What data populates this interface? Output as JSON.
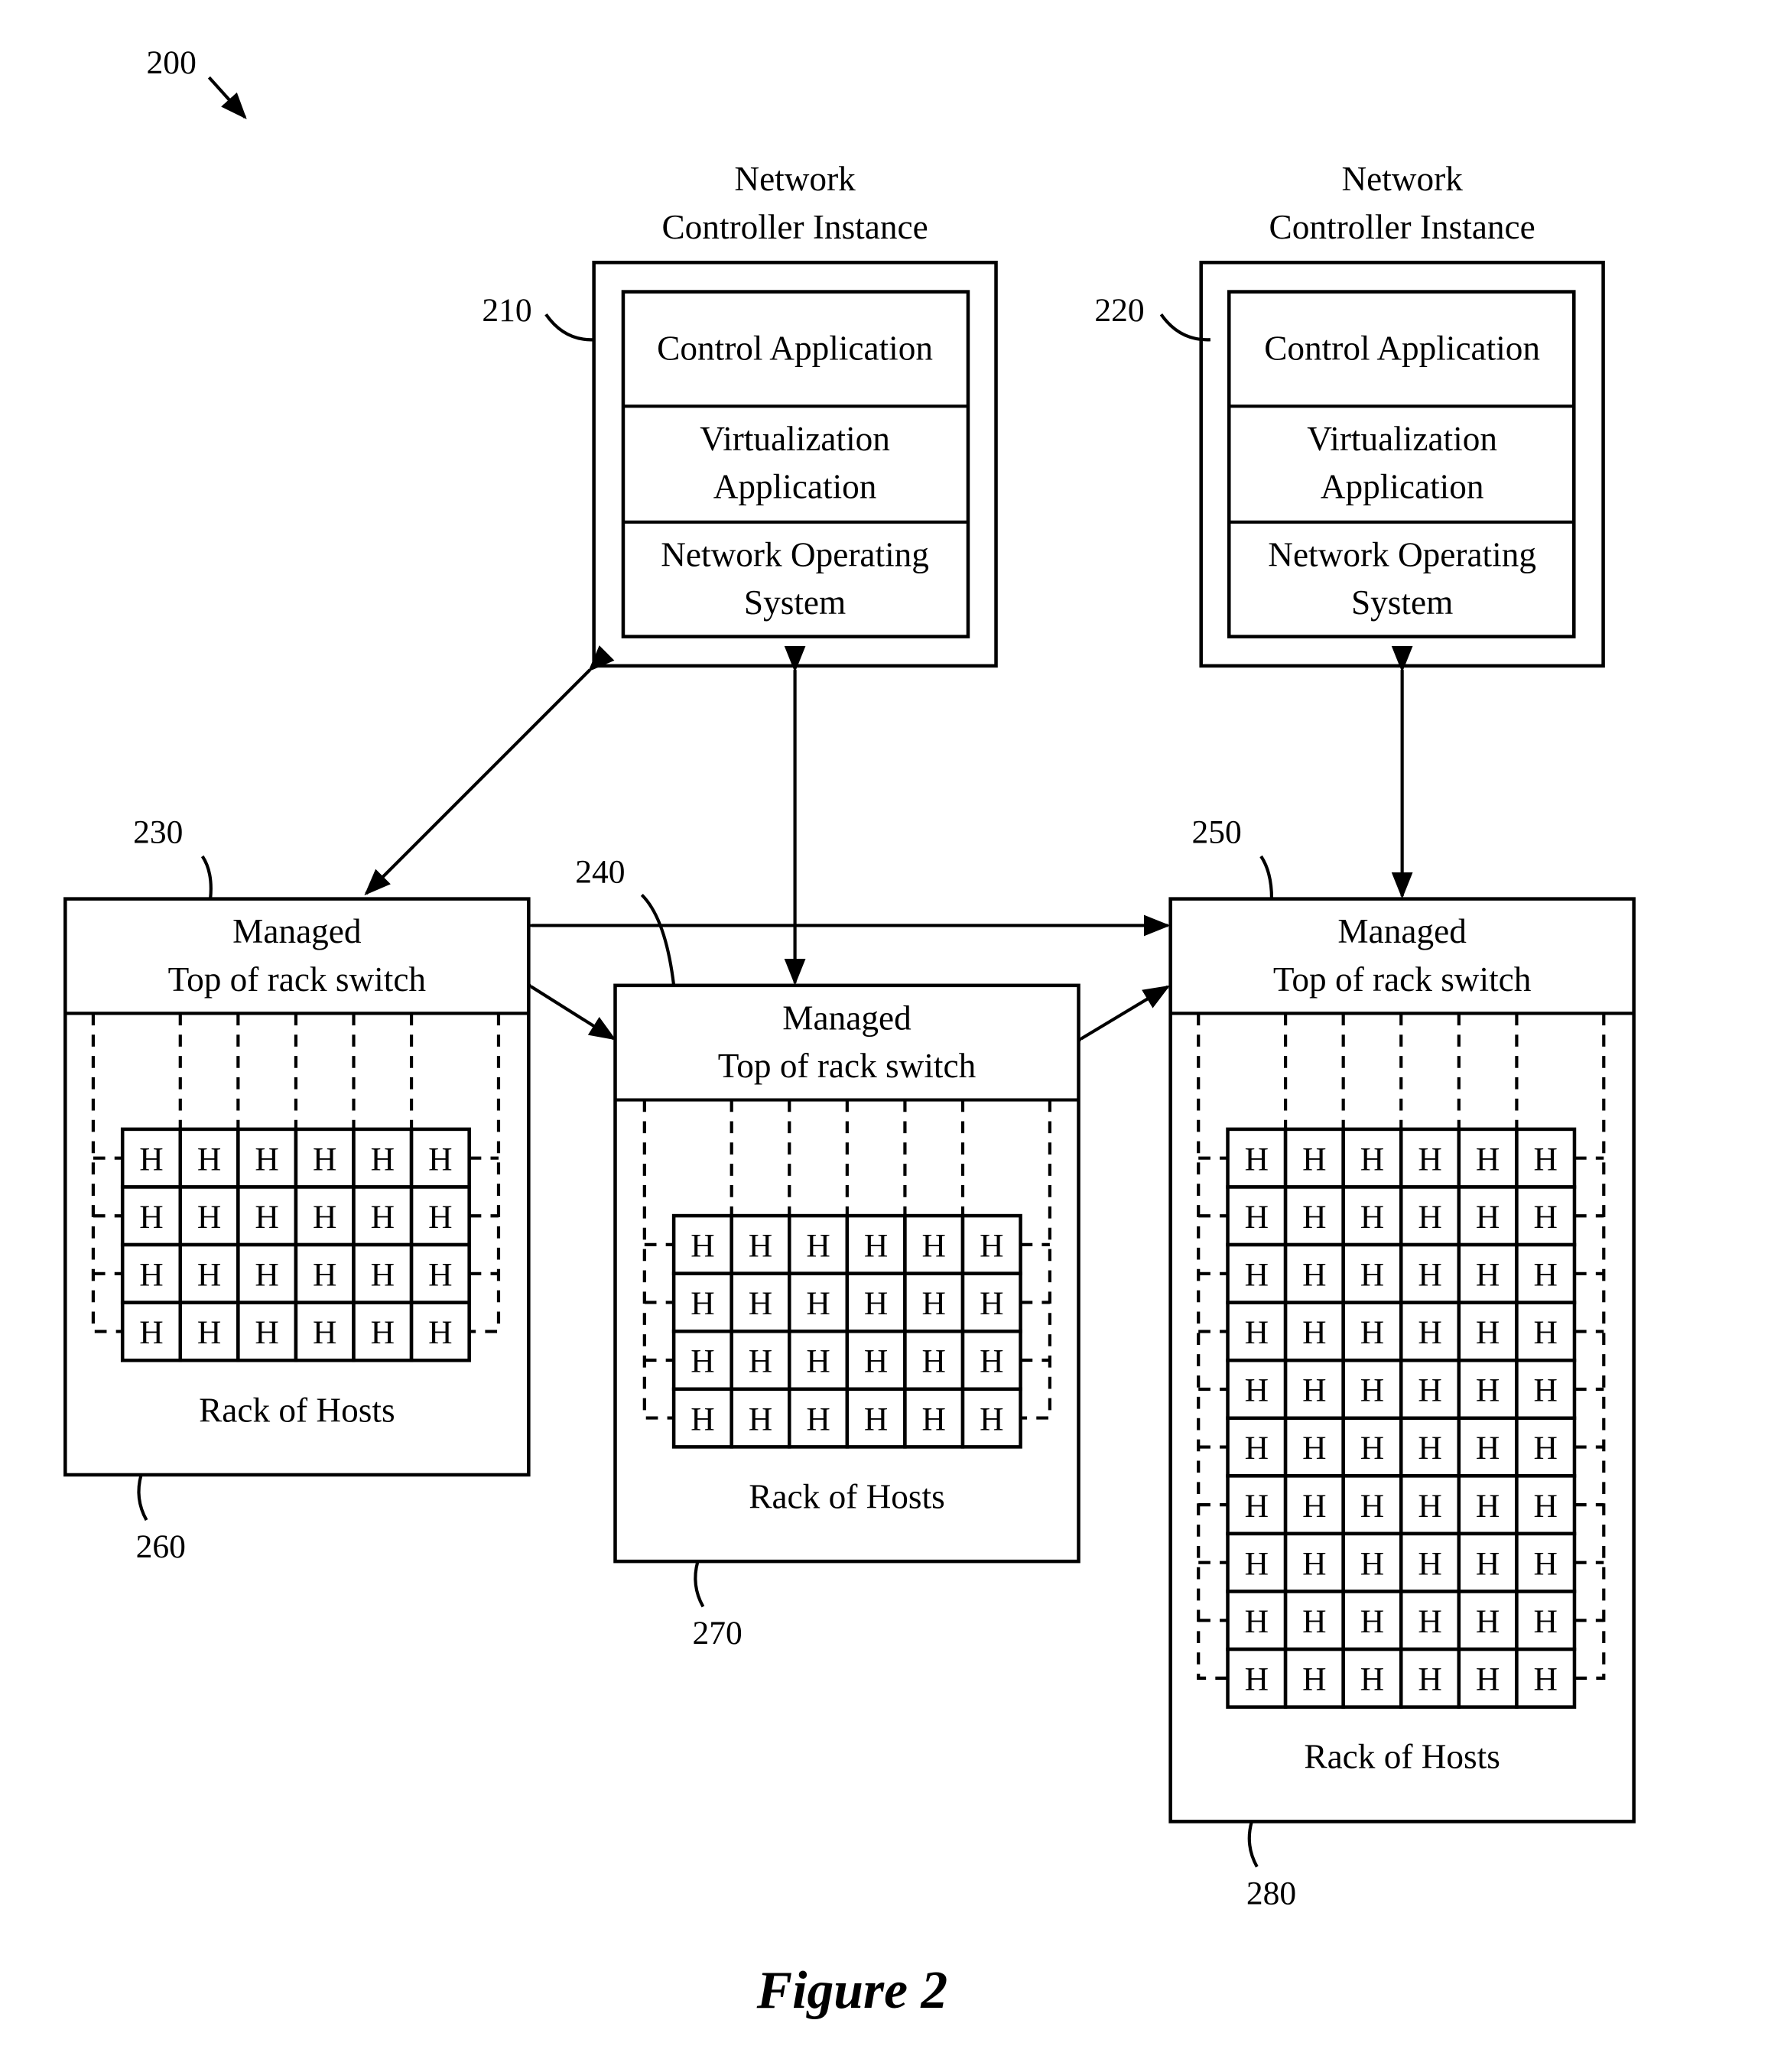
{
  "figure": {
    "ref": "200",
    "caption": "Figure 2"
  },
  "controllers": [
    {
      "ref": "210",
      "title_line1": "Network",
      "title_line2": "Controller Instance",
      "layers": [
        {
          "lines": [
            "Control Application"
          ]
        },
        {
          "lines": [
            "Virtualization",
            "Application"
          ]
        },
        {
          "lines": [
            "Network Operating",
            "System"
          ]
        }
      ]
    },
    {
      "ref": "220",
      "title_line1": "Network",
      "title_line2": "Controller Instance",
      "layers": [
        {
          "lines": [
            "Control Application"
          ]
        },
        {
          "lines": [
            "Virtualization",
            "Application"
          ]
        },
        {
          "lines": [
            "Network Operating",
            "System"
          ]
        }
      ]
    }
  ],
  "racks": [
    {
      "switch_ref": "230",
      "rack_ref": "260",
      "switch_line1": "Managed",
      "switch_line2": "Top of rack switch",
      "rack_label": "Rack of Hosts",
      "rows": 4,
      "cols": 6,
      "host_label": "H"
    },
    {
      "switch_ref": "240",
      "rack_ref": "270",
      "switch_line1": "Managed",
      "switch_line2": "Top of rack switch",
      "rack_label": "Rack of Hosts",
      "rows": 4,
      "cols": 6,
      "host_label": "H"
    },
    {
      "switch_ref": "250",
      "rack_ref": "280",
      "switch_line1": "Managed",
      "switch_line2": "Top of rack switch",
      "rack_label": "Rack of Hosts",
      "rows": 10,
      "cols": 6,
      "host_label": "H"
    }
  ]
}
